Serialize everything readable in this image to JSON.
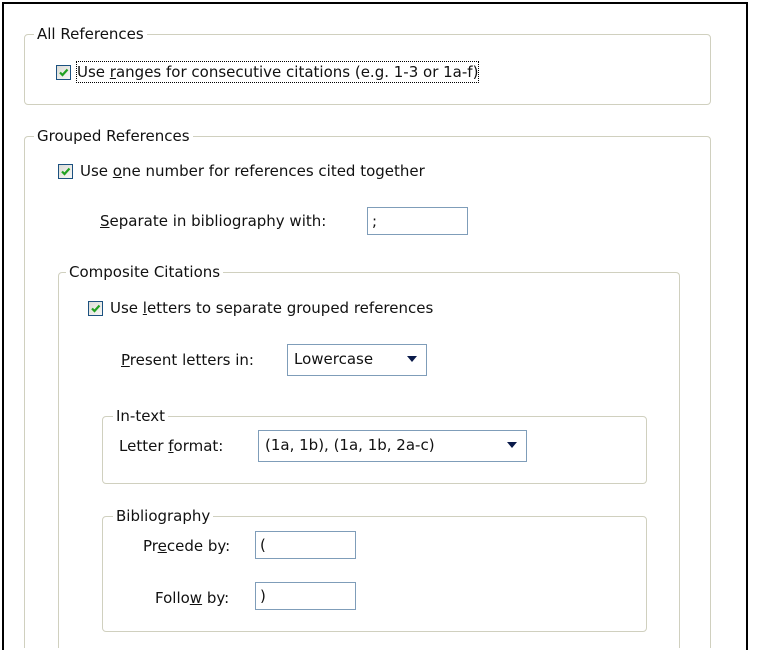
{
  "all_references": {
    "title": "All References",
    "use_ranges": {
      "checked": true,
      "pre": "Use ",
      "accel": "r",
      "post": "anges for consecutive citations (e.g. 1-3 or 1a-f)"
    }
  },
  "grouped_references": {
    "title": "Grouped References",
    "use_one_number": {
      "checked": true,
      "pre": "Use ",
      "accel": "o",
      "post": "ne number for references cited together"
    },
    "separate": {
      "pre": "",
      "accel": "S",
      "post": "eparate in bibliography with:",
      "value": ";"
    }
  },
  "composite_citations": {
    "title": "Composite Citations",
    "use_letters": {
      "checked": true,
      "pre": "Use ",
      "accel": "l",
      "post": "etters to separate grouped references"
    },
    "present_letters": {
      "pre": "",
      "accel": "P",
      "post": "resent letters in:",
      "value": "Lowercase"
    }
  },
  "in_text": {
    "title": "In-text",
    "letter_format": {
      "pre": "Letter ",
      "accel": "f",
      "post": "ormat:",
      "value": "(1a, 1b), (1a, 1b, 2a-c)"
    }
  },
  "bibliography": {
    "title": "Bibliography",
    "precede_by": {
      "pre": "Pr",
      "accel": "e",
      "post": "cede by:",
      "value": "("
    },
    "follow_by": {
      "pre": "Follo",
      "accel": "w",
      "post": " by:",
      "value": ")"
    }
  },
  "colors": {
    "check": "#21a121",
    "group_border": "#d0d0bf",
    "input_border": "#7f9db9"
  }
}
